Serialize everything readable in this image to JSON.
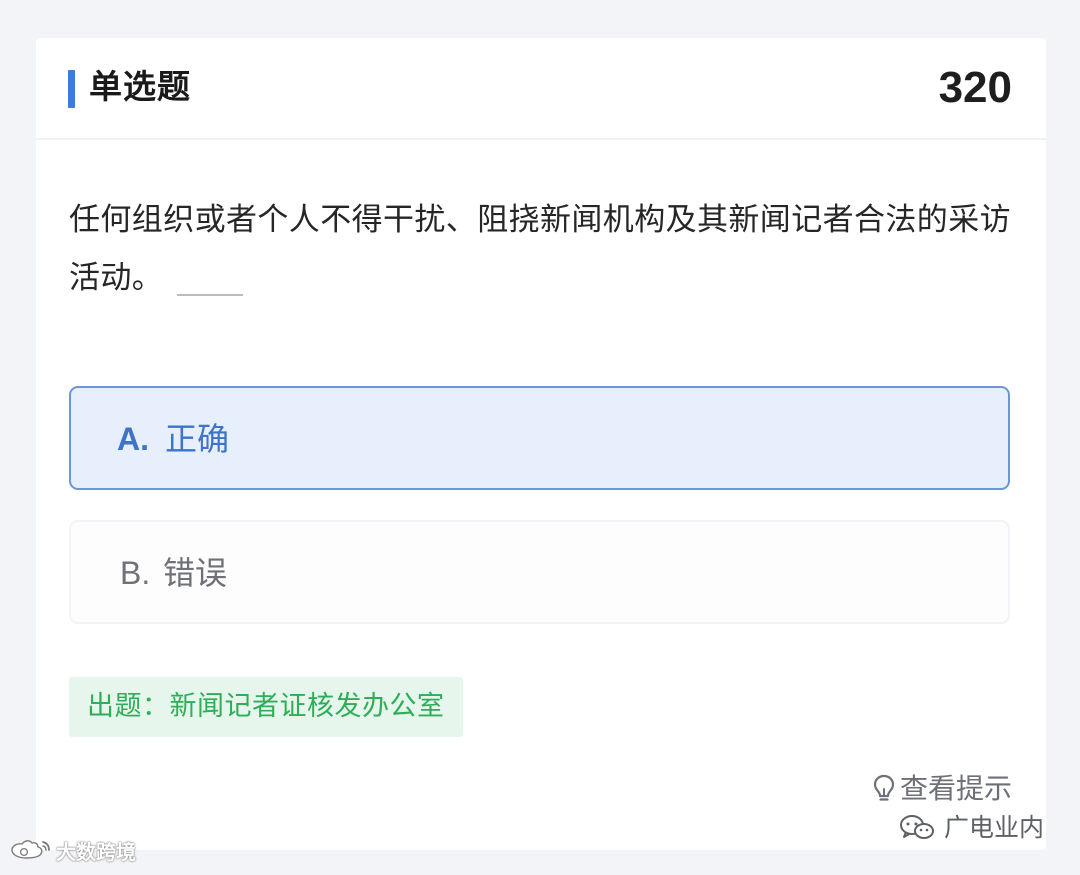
{
  "header": {
    "question_type": "单选题",
    "question_number": "320"
  },
  "question": {
    "text": "任何组织或者个人不得干扰、阻挠新闻机构及其新闻记者合法的采访活动。"
  },
  "options": [
    {
      "letter": "A.",
      "text": "正确",
      "selected": true
    },
    {
      "letter": "B.",
      "text": "错误",
      "selected": false
    }
  ],
  "source": {
    "text": "出题：新闻记者证核发办公室"
  },
  "hint": {
    "icon": "lightbulb-icon",
    "label": "查看提示"
  },
  "watermarks": {
    "right": "广电业内",
    "left": "大数跨境"
  },
  "colors": {
    "accent": "#3f7ae0",
    "selected_border": "#6d96d6",
    "selected_background": "#e8effc",
    "source_text": "#2fae59",
    "source_background": "#e7f6ec"
  }
}
